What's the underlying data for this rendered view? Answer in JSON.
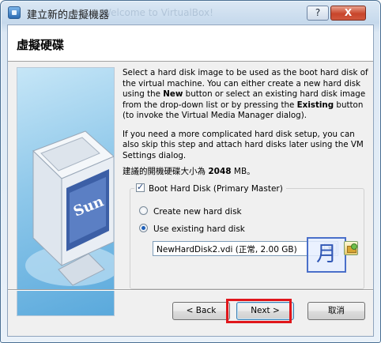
{
  "window": {
    "title": "建立新的虛擬機器",
    "ghost_title": "Welcome to VirtualBox!",
    "help_label": "?",
    "close_label": "X"
  },
  "header": {
    "title": "虛擬硬碟"
  },
  "body": {
    "desc1_a": "Select a hard disk image to be used as the boot hard disk of the virtual machine. You can either create a new hard disk using the ",
    "desc1_new": "New",
    "desc1_b": " button or select an existing hard disk image from the drop-down list or by pressing the ",
    "desc1_existing": "Existing",
    "desc1_c": " button (to invoke the Virtual Media Manager dialog).",
    "desc2": "If you need a more complicated hard disk setup, you can also skip this step and attach hard disks later using the VM Settings dialog.",
    "rec_prefix": "建議的開機硬碟大小為 ",
    "rec_size": "2048",
    "rec_suffix": " MB。"
  },
  "group": {
    "boot_label": "Boot Hard Disk (Primary Master)",
    "boot_checked": true,
    "create_label": "Create new hard disk",
    "existing_label": "Use existing hard disk",
    "selected": "existing",
    "combo_value": "NewHardDisk2.vdi (正常, 2.00 GB)",
    "ime_char": "月"
  },
  "icons": {
    "title": "virtualbox-app-icon",
    "combo": "chevron-down-icon",
    "folder": "open-folder-icon"
  },
  "logo_text": "Sun",
  "buttons": {
    "back": "< Back",
    "next": "Next >",
    "cancel": "取消"
  },
  "colors": {
    "highlight": "#e0161b",
    "title_gradient_top": "#dbe8f4"
  }
}
